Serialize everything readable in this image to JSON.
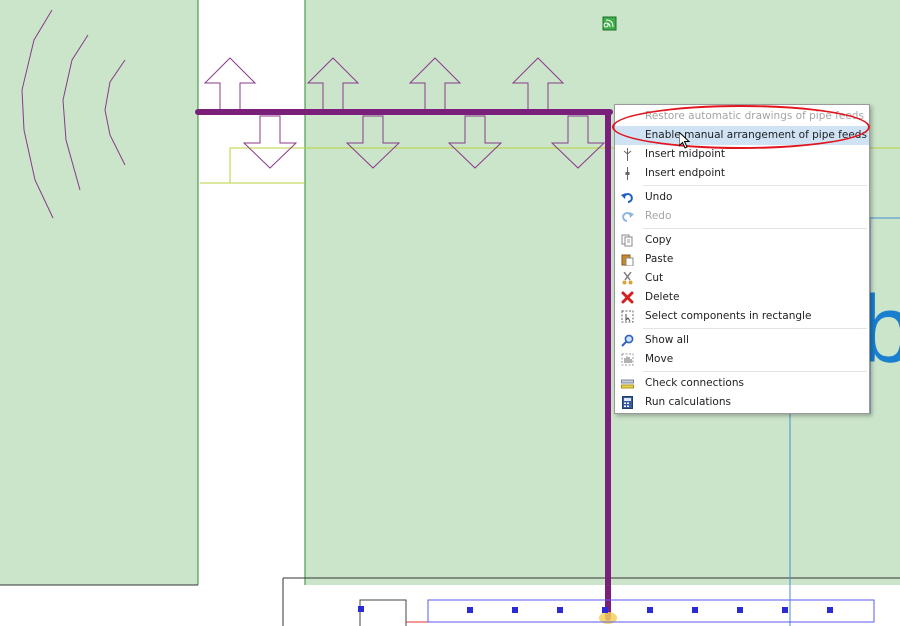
{
  "menu": {
    "items": [
      {
        "label": "Restore automatic drawings of pipe feeds",
        "disabled": true,
        "icon": "none"
      },
      {
        "label": "Enable manual arrangement of pipe feeds",
        "highlighted": true,
        "icon": "none"
      },
      {
        "label": "Insert midpoint",
        "icon": "insert-midpoint-icon"
      },
      {
        "label": "Insert endpoint",
        "icon": "insert-endpoint-icon"
      },
      {
        "label": "Undo",
        "icon": "undo-icon"
      },
      {
        "label": "Redo",
        "disabled": true,
        "icon": "redo-icon"
      },
      {
        "label": "Copy",
        "icon": "copy-icon"
      },
      {
        "label": "Paste",
        "icon": "paste-icon"
      },
      {
        "label": "Cut",
        "icon": "scissors-icon"
      },
      {
        "label": "Delete",
        "icon": "delete-x-icon"
      },
      {
        "label": "Select components in rectangle",
        "icon": "select-rectangle-icon"
      },
      {
        "label": "Show all",
        "icon": "magnifier-icon"
      },
      {
        "label": "Move",
        "icon": "move-hand-icon"
      },
      {
        "label": "Check connections",
        "icon": "check-connections-icon"
      },
      {
        "label": "Run calculations",
        "icon": "calculator-icon"
      }
    ]
  },
  "canvas": {
    "background_color": "#cbe5cb",
    "pipe_color": "#7a1f7a",
    "outline_color": "#7a3a7a",
    "annotation_color": "#e0151d",
    "large_glyph": "b",
    "large_glyph_color": "#1a7fcf"
  }
}
